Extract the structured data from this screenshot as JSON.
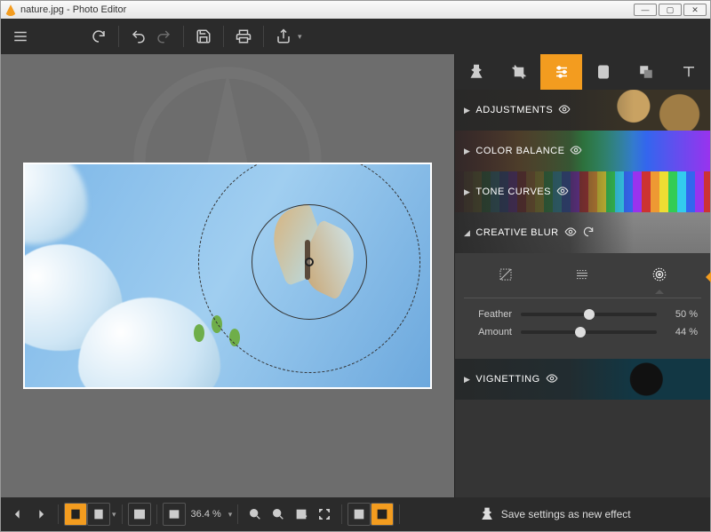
{
  "window": {
    "title": "nature.jpg - Photo Editor"
  },
  "panels": {
    "adjustments": "ADJUSTMENTS",
    "color_balance": "COLOR BALANCE",
    "tone_curves": "TONE CURVES",
    "creative_blur": "CREATIVE BLUR",
    "vignetting": "VIGNETTING"
  },
  "creative_blur": {
    "sliders": {
      "feather": {
        "label": "Feather",
        "value": 50,
        "display": "50 %"
      },
      "amount": {
        "label": "Amount",
        "value": 44,
        "display": "44 %"
      }
    }
  },
  "bottom": {
    "zoom_display": "36.4 %",
    "save_label": "Save settings as new effect"
  }
}
